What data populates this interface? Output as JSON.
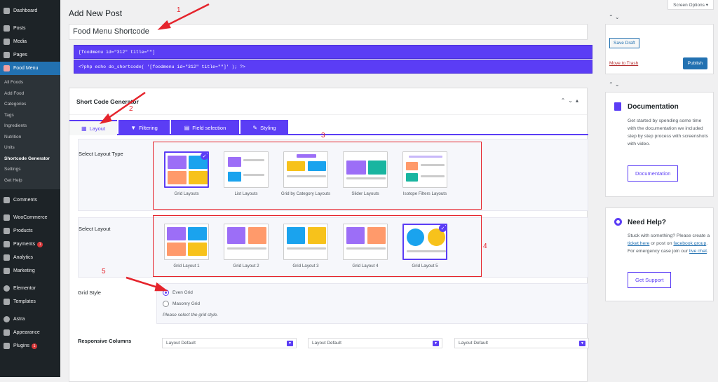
{
  "sidebar": {
    "top": [
      {
        "label": "Dashboard"
      },
      {
        "label": "Posts"
      },
      {
        "label": "Media"
      },
      {
        "label": "Pages"
      }
    ],
    "active": {
      "label": "Food Menu"
    },
    "sub": [
      "All Foods",
      "Add Food",
      "Categories",
      "Tags",
      "Ingredients",
      "Nutrition",
      "Units",
      "Shortcode Generator",
      "Settings",
      "Get Help"
    ],
    "current_sub": "Shortcode Generator",
    "bottom": [
      {
        "label": "Comments"
      },
      {
        "label": "WooCommerce"
      },
      {
        "label": "Products"
      },
      {
        "label": "Payments",
        "badge": "1"
      },
      {
        "label": "Analytics"
      },
      {
        "label": "Marketing"
      },
      {
        "label": "Elementor"
      },
      {
        "label": "Templates"
      },
      {
        "label": "Astra"
      },
      {
        "label": "Appearance"
      },
      {
        "label": "Plugins",
        "badge": "1"
      }
    ]
  },
  "header": {
    "page_title": "Add New Post",
    "screen_options": "Screen Options ▾",
    "post_title": "Food Menu Shortcode"
  },
  "shortcodes": {
    "line1": "[foodmenu id=\"312\" title=\"\"]",
    "line2": "<?php echo do_shortcode( '[foodmenu id=\"312\" title=\"\"]' ); ?>"
  },
  "generator": {
    "title": "Short Code Generator",
    "controls": "⌃⌄▴",
    "tabs": [
      {
        "label": "Layout",
        "icon": "▦"
      },
      {
        "label": "Filtering",
        "icon": "▼"
      },
      {
        "label": "Field selection",
        "icon": "▤"
      },
      {
        "label": "Styling",
        "icon": "✎"
      }
    ],
    "layout_type_label": "Select Layout Type",
    "layout_types": [
      {
        "label": "Grid Layouts",
        "selected": true
      },
      {
        "label": "List Layouts"
      },
      {
        "label": "Grid by Category Layouts"
      },
      {
        "label": "Slider Layouts"
      },
      {
        "label": "Isotope Filters Layouts"
      }
    ],
    "layout_label": "Select Layout",
    "layouts": [
      {
        "label": "Grid Layout 1"
      },
      {
        "label": "Grid Layout 2"
      },
      {
        "label": "Grid Layout 3"
      },
      {
        "label": "Grid Layout 4"
      },
      {
        "label": "Grid Layout 5",
        "selected": true
      }
    ],
    "grid_style_label": "Grid Style",
    "grid_styles": [
      {
        "label": "Even Grid",
        "checked": true
      },
      {
        "label": "Masonry Grid",
        "checked": false
      }
    ],
    "grid_hint": "Please select the grid style.",
    "responsive_label": "Responsive Columns",
    "selects": [
      "Layout Default",
      "Layout Default",
      "Layout Default"
    ]
  },
  "publish": {
    "save_draft": "Save Draft",
    "trash": "Move to Trash",
    "publish": "Publish",
    "controls": "⌃ ⌄"
  },
  "docs": {
    "title": "Documentation",
    "text": "Get started by spending some time with the documentation we included step by step process with screenshots with video.",
    "button": "Documentation"
  },
  "help": {
    "title": "Need Help?",
    "text_1": "Stuck with something? Please create a",
    "link_1": "ticket here",
    "text_2": "or post on",
    "link_2": "facebook group",
    "text_3": ". For emergency case join our",
    "link_3": "live chat",
    "text_4": ".",
    "button": "Get Support"
  },
  "annotations": [
    "1",
    "2",
    "3",
    "4",
    "5"
  ],
  "colors": {
    "accent": "#5b3df5",
    "annotation": "#e5242c",
    "wp_blue": "#2271b1"
  }
}
